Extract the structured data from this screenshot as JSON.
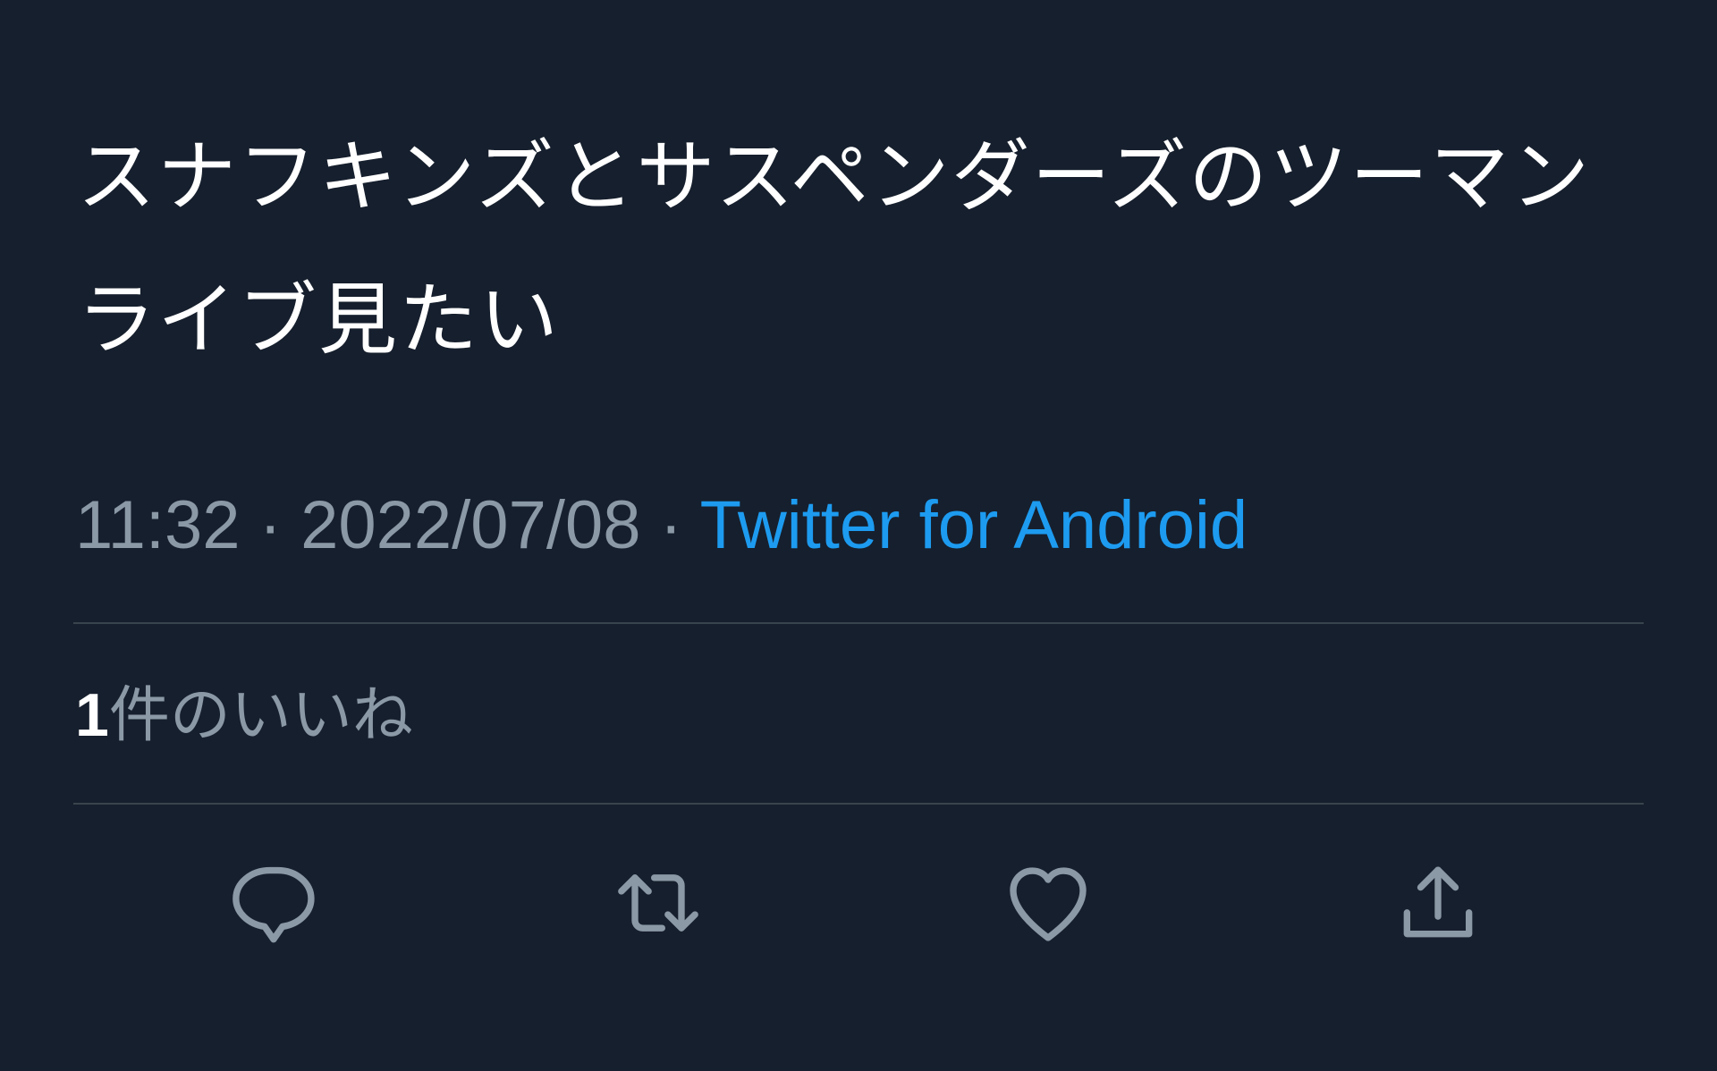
{
  "tweet": {
    "text": "スナフキンズとサスペンダーズのツーマンライブ見たい",
    "time": "11:32",
    "date": "2022/07/08",
    "separator": "·",
    "source": "Twitter for Android"
  },
  "likes": {
    "count": "1",
    "label": "件のいいね"
  },
  "actions": [
    {
      "icon": "reply-icon"
    },
    {
      "icon": "retweet-icon"
    },
    {
      "icon": "like-icon"
    },
    {
      "icon": "share-icon"
    }
  ],
  "colors": {
    "background": "#161f2d",
    "text": "#ffffff",
    "secondary": "#8b98a5",
    "accent": "#1d9bf0",
    "divider": "#38444d"
  }
}
